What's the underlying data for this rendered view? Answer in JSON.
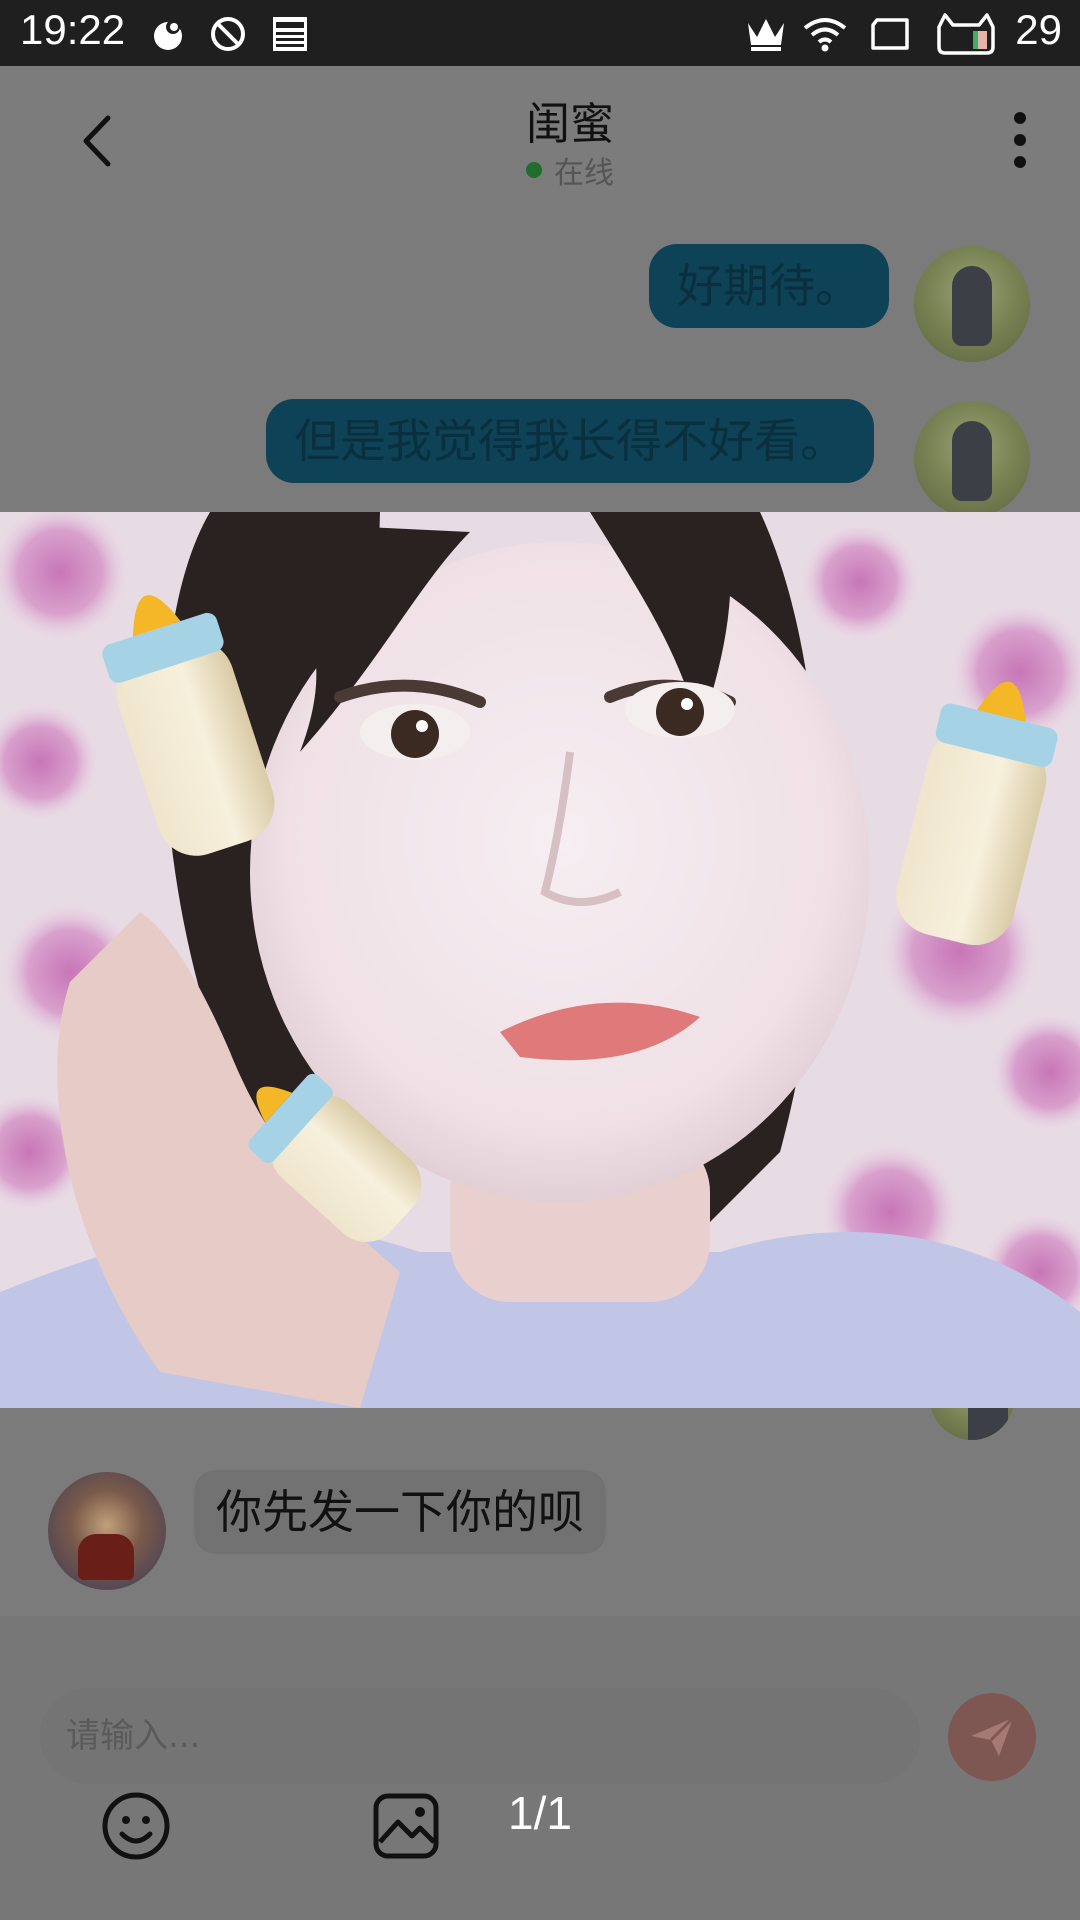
{
  "status_bar": {
    "time": "19:22",
    "battery": "29",
    "icons": [
      "bubble-icon",
      "blocked-icon",
      "news-icon",
      "crown-icon",
      "wifi-icon",
      "sim-icon",
      "cat-battery-icon"
    ]
  },
  "chat": {
    "title": "闺蜜",
    "status": "在线",
    "messages": [
      {
        "side": "out",
        "text": "好期待。"
      },
      {
        "side": "out",
        "text": "但是我觉得我长得不好看。"
      },
      {
        "side": "in",
        "text": "你先发一下你的呗"
      }
    ]
  },
  "composer": {
    "placeholder": "请输入..."
  },
  "viewer": {
    "counter": "1/1"
  },
  "colors": {
    "status_bar": "#1f1f1f",
    "outgoing_bubble": "#0d4257",
    "send_button": "#7e5752",
    "online_dot": "#1f6e2c"
  }
}
